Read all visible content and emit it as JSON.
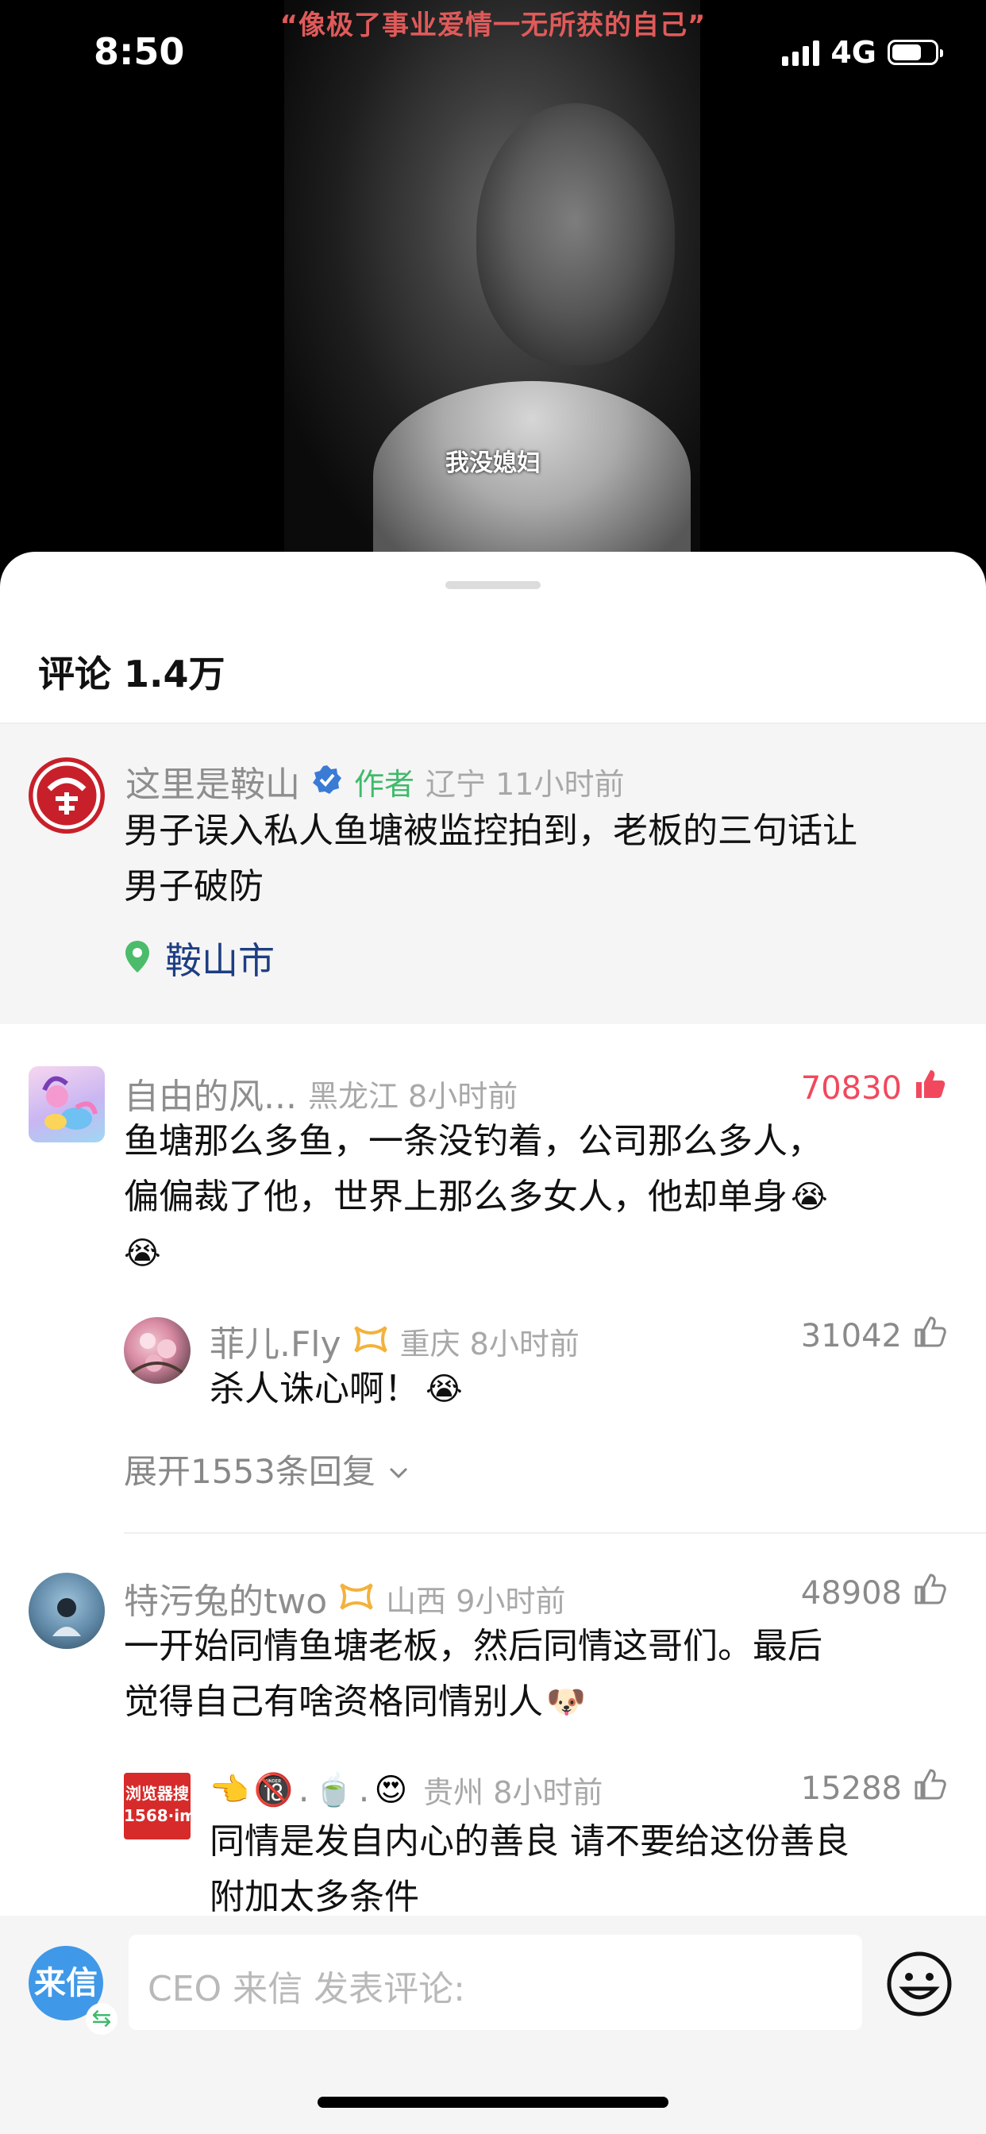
{
  "status": {
    "time": "8:50",
    "network": "4G"
  },
  "video": {
    "title": "“像极了事业爱情一无所获的自己”",
    "subtitle": "我没媳妇"
  },
  "comments_panel": {
    "title": "评论 1.4万"
  },
  "author_post": {
    "name": "这里是鞍山",
    "tag": "作者",
    "meta": "辽宁 11小时前",
    "text_line1": "男子误入私人鱼塘被监控拍到，老板的三句话让",
    "text_line2": "男子破防",
    "location": "鞍山市"
  },
  "comments": [
    {
      "name": "自由的风...",
      "meta": "黑龙江 8小时前",
      "likes": "70830",
      "text_line1": "鱼塘那么多鱼，一条没钓着，公司那么多人，",
      "text_line2": "偏偏裁了他，世界上那么多女人，他却单身",
      "emoji": "😭",
      "reply": {
        "name": "菲儿.Fly",
        "meta": "重庆 8小时前",
        "likes": "31042",
        "text": "杀人诛心啊！",
        "emoji": "😭"
      },
      "expand": "展开1553条回复"
    },
    {
      "name": "特污兔的two",
      "meta": "山西 9小时前",
      "likes": "48908",
      "text_line1": "一开始同情鱼塘老板，然后同情这哥们。最后",
      "text_line2": "觉得自己有啥资格同情别人",
      "emoji": "🐶",
      "reply": {
        "name_emojis": [
          "👈",
          "🔞",
          ".",
          "🍵",
          ".",
          "😍"
        ],
        "avatar_text": "浏览器搜 1568·im",
        "meta": "贵州 8小时前",
        "likes": "15288",
        "text_line1": "同情是发自内心的善良 请不要给这份善良",
        "text_line2": "附加太多条件"
      }
    }
  ],
  "bottom_bar": {
    "laixin_label": "来信",
    "placeholder": "CEO 来信 发表评论:"
  },
  "colors": {
    "hot_like": "#f2485d",
    "author_tag": "#3fba6b",
    "verified": "#3a7bd5",
    "location_pin": "#4cbc6b",
    "location_text": "#1d3e83"
  }
}
